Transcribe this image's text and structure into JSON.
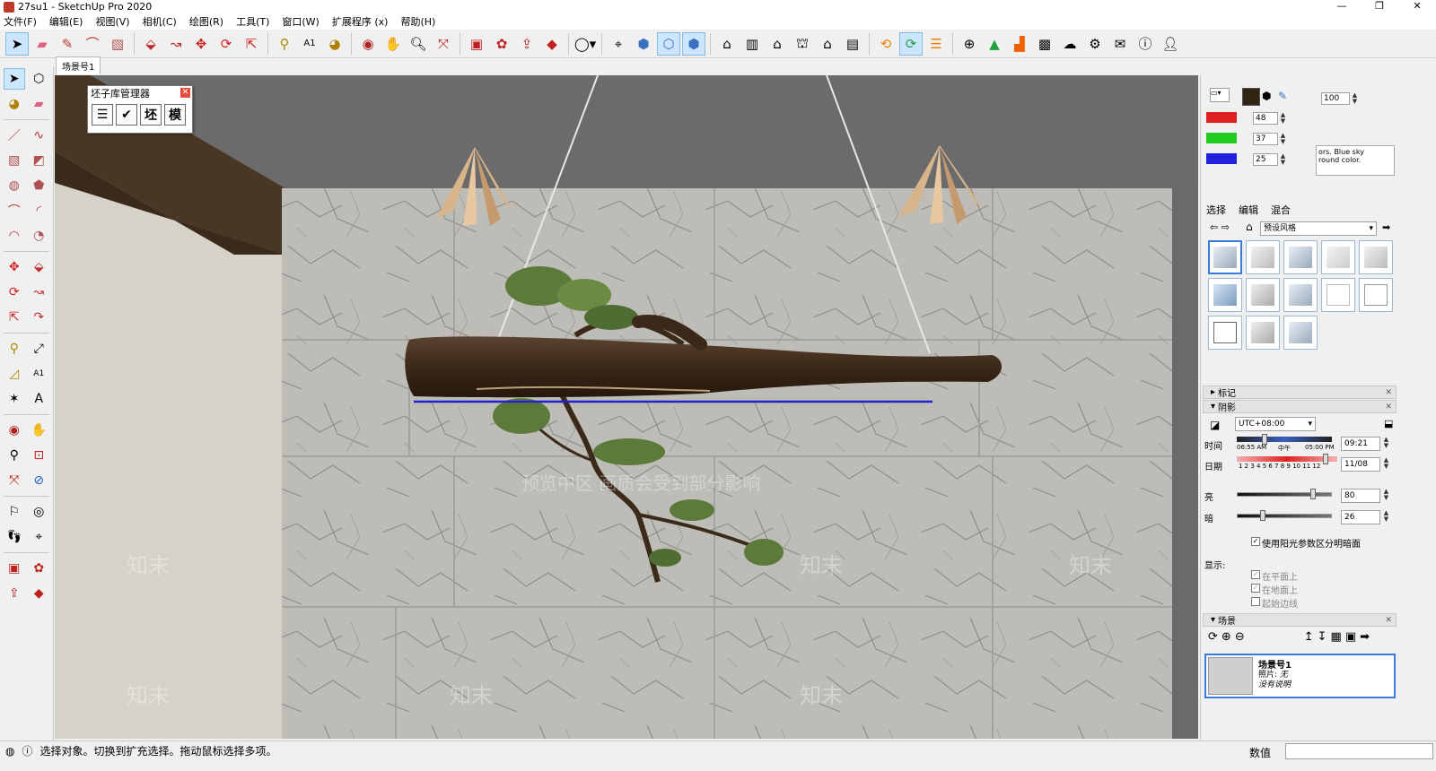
{
  "window": {
    "title": "27su1 - SketchUp Pro 2020",
    "minimize": "—",
    "maximize": "❐",
    "close": "✕"
  },
  "menu": [
    "文件(F)",
    "编辑(E)",
    "视图(V)",
    "相机(C)",
    "绘图(R)",
    "工具(T)",
    "窗口(W)",
    "扩展程序 (x)",
    "帮助(H)"
  ],
  "toolbar": {
    "icons": [
      "select-icon",
      "eraser-icon",
      "pencil-icon",
      "arc-icon",
      "rectangle-icon",
      "pushpull-icon",
      "followme-icon",
      "move-icon",
      "rotate-icon",
      "scale-icon",
      "tape-icon",
      "text-icon",
      "paint-icon",
      "orbit-icon",
      "pan-icon",
      "zoom-icon",
      "zoom-extents-icon",
      "warehouse-icon",
      "extension-icon",
      "send-icon",
      "ruby-icon",
      "account-icon",
      "section-icon",
      "xray-icon",
      "hidden-icon",
      "shaded-icon",
      "house-icon",
      "building-icon",
      "home-icon",
      "shop-icon",
      "roof-icon",
      "garage-icon",
      "plugin-a-icon",
      "refresh-icon",
      "plugin-b-icon",
      "plus-icon",
      "tree-icon",
      "stairs-icon",
      "grid-icon",
      "cloud-icon",
      "gear-icon",
      "mail-icon",
      "info-icon",
      "user-icon"
    ]
  },
  "scene_tab": "场景号1",
  "manager": {
    "title": "坯子库管理器",
    "buttons": [
      "☰",
      "✔",
      "坯",
      "模"
    ]
  },
  "watermark": {
    "text": "知末",
    "notice": "预览中区 画质会受到部分影响"
  },
  "status": {
    "message": "选择对象。切换到扩充选择。拖动鼠标选择多项。",
    "value_label": "数值",
    "value": ""
  },
  "colors": {
    "wall": "#b9b8b2",
    "ceiling": "#6b6b6b",
    "beam": "#4a3624",
    "log": "#3d2a1a",
    "foliage": "#5c7a3a",
    "blue_line": "#2222cc",
    "lamp": "#d8b48a"
  },
  "materials": {
    "opacity": "100",
    "red": "48",
    "green": "37",
    "blue": "25",
    "note": "ors. Blue sky\nround color."
  },
  "styles": {
    "tabs": [
      "选择",
      "编辑",
      "混合"
    ],
    "preset": "预设风格"
  },
  "tags_header": "标记",
  "shadows": {
    "header": "阴影",
    "timezone": "UTC+08:00",
    "time_label": "时间",
    "time_start": "06:55 AM",
    "time_mid": "中午",
    "time_end": "05:00 PM",
    "time_value": "09:21",
    "date_label": "日期",
    "months": "1 2 3 4 5 6 7 8 9 10 11 12",
    "date_value": "11/08",
    "light_label": "亮",
    "light_value": "80",
    "dark_label": "暗",
    "dark_value": "26",
    "use_sun": "使用阳光参数区分明暗面",
    "display_label": "显示:",
    "on_faces": "在平面上",
    "on_ground": "在地面上",
    "from_edges": "起始边线"
  },
  "scenes": {
    "header": "场景",
    "name": "场景号1",
    "photo_label": "照片:",
    "photo_value": "无",
    "desc": "没有说明"
  }
}
